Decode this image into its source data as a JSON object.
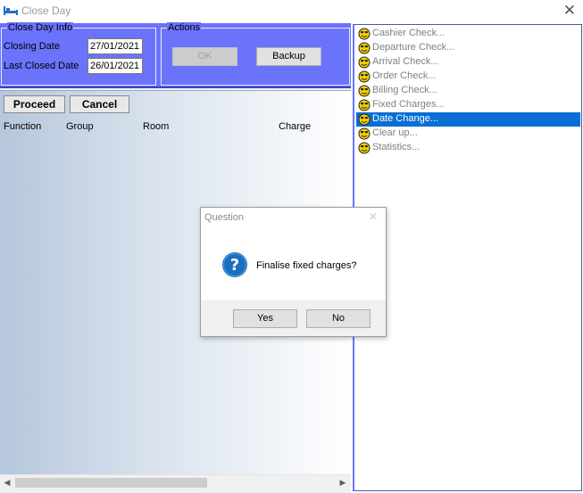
{
  "window": {
    "title": "Close Day",
    "icon": "bed-icon",
    "close_glyph": "✕"
  },
  "close_day_info": {
    "legend": "Close Day Info",
    "closing_date_label": "Closing Date",
    "closing_date_value": "27/01/2021",
    "last_closed_date_label": "Last Closed Date",
    "last_closed_date_value": "26/01/2021"
  },
  "actions": {
    "legend": "Actions",
    "ok_label": "OK",
    "backup_label": "Backup"
  },
  "toolbar": {
    "proceed_label": "Proceed",
    "cancel_label": "Cancel"
  },
  "grid": {
    "columns": [
      "Function",
      "Group",
      "Room",
      "Charge"
    ]
  },
  "scrollbar": {
    "left_arrow": "◀",
    "right_arrow": "▶"
  },
  "tasks": {
    "icon": "smiley-face-icon",
    "items": [
      "Cashier Check...",
      "Departure Check...",
      "Arrival Check...",
      "Order Check...",
      "Billing Check...",
      "Fixed Charges...",
      "Date Change...",
      "Clear up...",
      "Statistics..."
    ],
    "active": "Date Change..."
  },
  "dialog": {
    "title": "Question",
    "close_glyph": "✕",
    "icon": "question-icon",
    "message": "Finalise fixed charges?",
    "yes_label": "Yes",
    "no_label": "No"
  },
  "colors": {
    "header_band": "#6a73fa",
    "selection": "#0a6fd4",
    "question_icon": "#1a6fc0"
  }
}
